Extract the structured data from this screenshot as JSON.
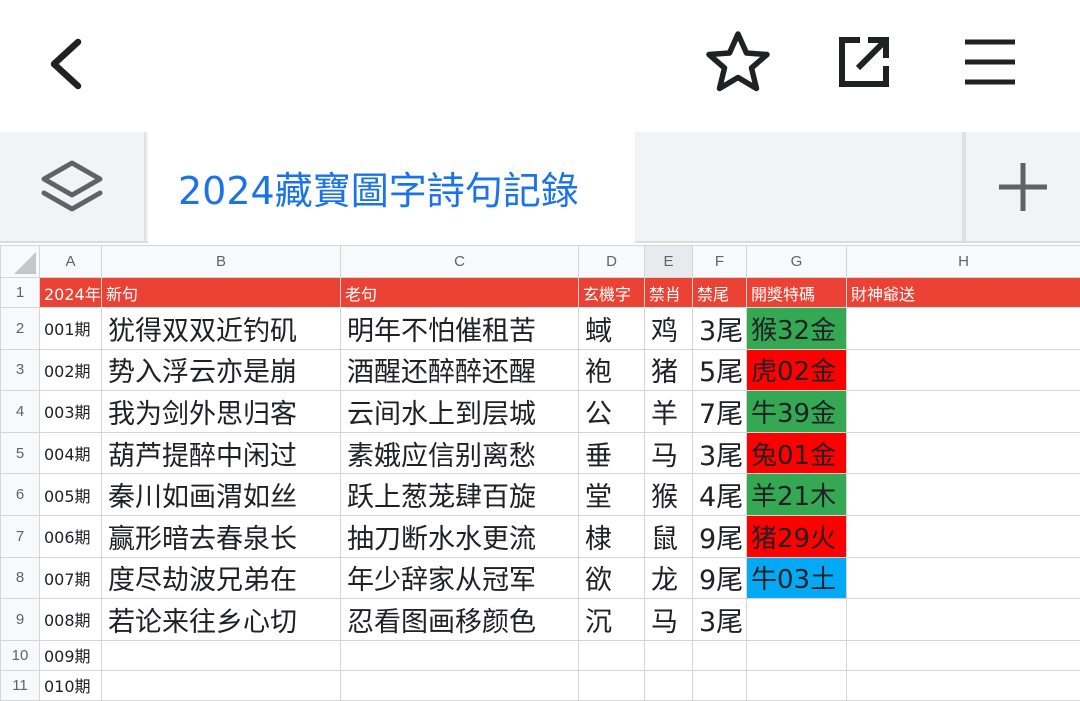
{
  "appbar": {
    "back_icon": "chevron-left-icon",
    "star_icon": "star-outline-icon",
    "open_icon": "open-in-new-icon",
    "menu_icon": "hamburger-menu-icon"
  },
  "tabbar": {
    "sheet_title": "2024藏寶圖字詩句記錄",
    "layers_icon": "layers-icon",
    "add_icon": "plus-icon"
  },
  "grid": {
    "columns": [
      "A",
      "B",
      "C",
      "D",
      "E",
      "F",
      "G",
      "H"
    ],
    "selected_column": "E",
    "header_row": {
      "row_num": "1",
      "cells": [
        "2024年",
        "新句",
        "老句",
        "玄機字",
        "禁肖",
        "禁尾",
        "開獎特碼",
        "財神爺送"
      ]
    },
    "rows": [
      {
        "row_num": "2",
        "period": "001期",
        "new": "犹得双双近钓矶",
        "old": "明年不怕催租苦",
        "word": "蜮",
        "zodiac": "鸡",
        "tail": "3尾",
        "code": "猴32金",
        "code_bg": "#34a853",
        "code_color": "#202124"
      },
      {
        "row_num": "3",
        "period": "002期",
        "new": "势入浮云亦是崩",
        "old": "酒醒还醉醉还醒",
        "word": "袍",
        "zodiac": "猪",
        "tail": "5尾",
        "code": "虎02金",
        "code_bg": "#ff0000",
        "code_color": "#202124"
      },
      {
        "row_num": "4",
        "period": "003期",
        "new": "我为剑外思归客",
        "old": "云间水上到层城",
        "word": "公",
        "zodiac": "羊",
        "tail": "7尾",
        "code": "牛39金",
        "code_bg": "#34a853",
        "code_color": "#202124"
      },
      {
        "row_num": "5",
        "period": "004期",
        "new": "葫芦提醉中闲过",
        "old": "素娥应信别离愁",
        "word": "垂",
        "zodiac": "马",
        "tail": "3尾",
        "code": "兔01金",
        "code_bg": "#ff0000",
        "code_color": "#202124"
      },
      {
        "row_num": "6",
        "period": "005期",
        "new": "秦川如画渭如丝",
        "old": "跃上葱茏肆百旋",
        "word": "堂",
        "zodiac": "猴",
        "tail": "4尾",
        "code": "羊21木",
        "code_bg": "#34a853",
        "code_color": "#202124"
      },
      {
        "row_num": "7",
        "period": "006期",
        "new": "赢形暗去春泉长",
        "old": "抽刀断水水更流",
        "word": "棣",
        "zodiac": "鼠",
        "tail": "9尾",
        "code": "猪29火",
        "code_bg": "#ff0000",
        "code_color": "#202124"
      },
      {
        "row_num": "8",
        "period": "007期",
        "new": "度尽劫波兄弟在",
        "old": "年少辞家从冠军",
        "word": "欲",
        "zodiac": "龙",
        "tail": "9尾",
        "code": "牛03土",
        "code_bg": "#03a9f4",
        "code_color": "#202124"
      },
      {
        "row_num": "9",
        "period": "008期",
        "new": "若论来往乡心切",
        "old": "忍看图画移颜色",
        "word": "沉",
        "zodiac": "马",
        "tail": "3尾",
        "code": "",
        "code_bg": "",
        "code_color": ""
      }
    ],
    "empty_rows": [
      {
        "row_num": "10",
        "period": "009期"
      },
      {
        "row_num": "11",
        "period": "010期"
      }
    ]
  }
}
